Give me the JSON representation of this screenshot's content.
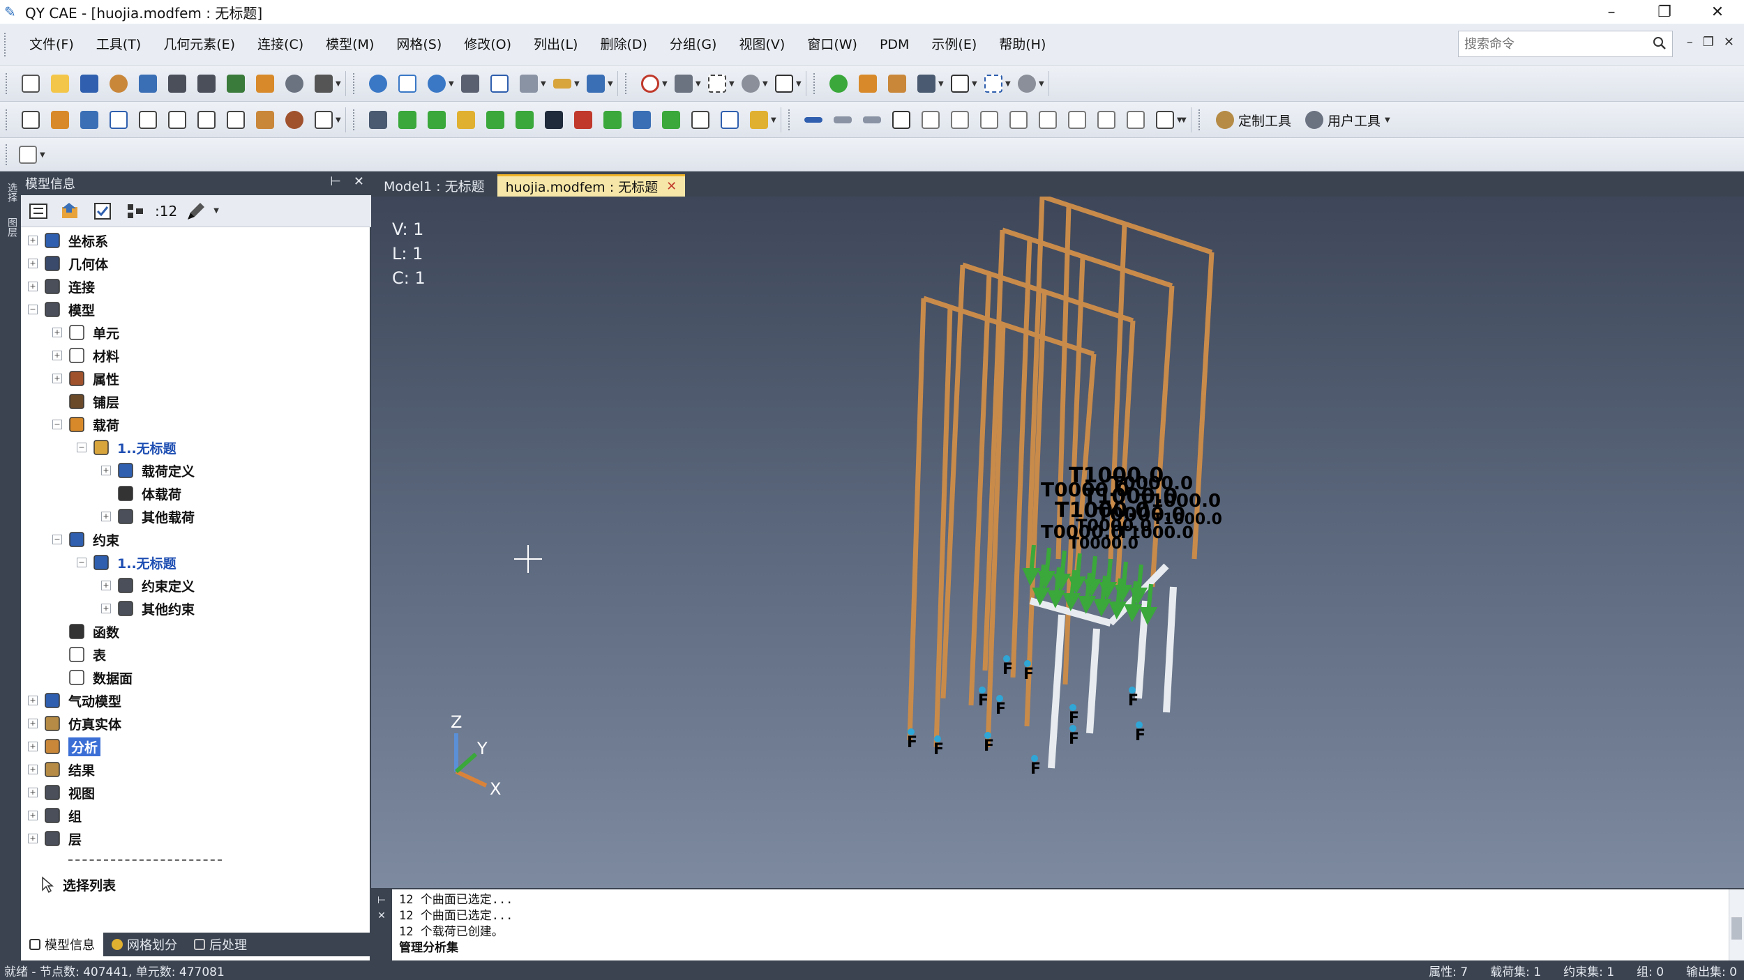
{
  "window": {
    "title": "QY CAE - [huojia.modfem : 无标题]",
    "controls": [
      "–",
      "❐",
      "✕"
    ]
  },
  "menubar": {
    "items": [
      "文件(F)",
      "工具(T)",
      "几何元素(E)",
      "连接(C)",
      "模型(M)",
      "网格(S)",
      "修改(O)",
      "列出(L)",
      "删除(D)",
      "分组(G)",
      "视图(V)",
      "窗口(W)",
      "PDM",
      "示例(E)",
      "帮助(H)"
    ],
    "search_placeholder": "搜索命令",
    "mdi_controls": [
      "–",
      "❐",
      "✕"
    ]
  },
  "toolbar": {
    "custom_tools": "定制工具",
    "user_tools": "用户工具"
  },
  "left_panel": {
    "title": "模型信息",
    "header_buttons": [
      "⊢",
      "✕"
    ],
    "count": ":12",
    "tree": [
      {
        "label": "坐标系",
        "icon": "axes-icon"
      },
      {
        "label": "几何体",
        "icon": "geometry-icon"
      },
      {
        "label": "连接",
        "icon": "connection-icon"
      },
      {
        "label": "模型",
        "icon": "model-icon"
      },
      {
        "label": "单元",
        "icon": "element-icon"
      },
      {
        "label": "材料",
        "icon": "material-icon"
      },
      {
        "label": "属性",
        "icon": "property-icon"
      },
      {
        "label": "铺层",
        "icon": "layup-icon"
      },
      {
        "label": "载荷",
        "icon": "load-icon"
      },
      {
        "label": "1..无标题",
        "icon": "loadset-icon"
      },
      {
        "label": "载荷定义",
        "icon": "load-definition-icon"
      },
      {
        "label": "体载荷",
        "icon": "body-load-icon"
      },
      {
        "label": "其他载荷",
        "icon": "other-load-icon"
      },
      {
        "label": "约束",
        "icon": "constraint-icon"
      },
      {
        "label": "1..无标题",
        "icon": "constraintset-icon"
      },
      {
        "label": "约束定义",
        "icon": "constraint-definition-icon"
      },
      {
        "label": "其他约束",
        "icon": "other-constraint-icon"
      },
      {
        "label": "函数",
        "icon": "function-icon"
      },
      {
        "label": "表",
        "icon": "table-icon"
      },
      {
        "label": "数据面",
        "icon": "data-surface-icon"
      },
      {
        "label": "气动模型",
        "icon": "aero-model-icon"
      },
      {
        "label": "仿真实体",
        "icon": "sim-entity-icon"
      },
      {
        "label": "分析",
        "icon": "analysis-icon"
      },
      {
        "label": "结果",
        "icon": "results-icon"
      },
      {
        "label": "视图",
        "icon": "view-icon"
      },
      {
        "label": "组",
        "icon": "group-icon"
      },
      {
        "label": "层",
        "icon": "layer-icon"
      },
      {
        "label": "选择列表",
        "icon": "selection-list-icon"
      }
    ],
    "bottom_tabs": [
      "模型信息",
      "网格划分",
      "后处理"
    ]
  },
  "left_strip": {
    "tabs": [
      "选择",
      "图层"
    ]
  },
  "doc_tabs": {
    "tab1": "Model1 : 无标题",
    "tab2": "huojia.modfem : 无标题",
    "close": "✕"
  },
  "viewport": {
    "v": "V: 1",
    "l": "L: 1",
    "c": "C: 1",
    "axis_x": "X",
    "axis_y": "Y",
    "axis_z": "Z",
    "constraint_marker": "F",
    "load_label_a": "T1000.0",
    "load_label_b": "T0000.0"
  },
  "output": {
    "lines": [
      "12 个曲面已选定...",
      "12 个曲面已选定...",
      "12 个载荷已创建。"
    ],
    "bold_line": "管理分析集"
  },
  "statusbar": {
    "left": "就绪 - 节点数: 407441, 单元数: 477081",
    "right": [
      "属性: 7",
      "载荷集: 1",
      "约束集: 1",
      "组: 0",
      "输出集: 0"
    ]
  },
  "colors": {
    "panel_dark": "#3b4350",
    "beam_orange": "#c98b4a",
    "beam_white": "#e8ecf0",
    "load_green": "#3aa83a",
    "selection_blue": "#3b6fd6",
    "tab_active": "#f6e7a8"
  }
}
